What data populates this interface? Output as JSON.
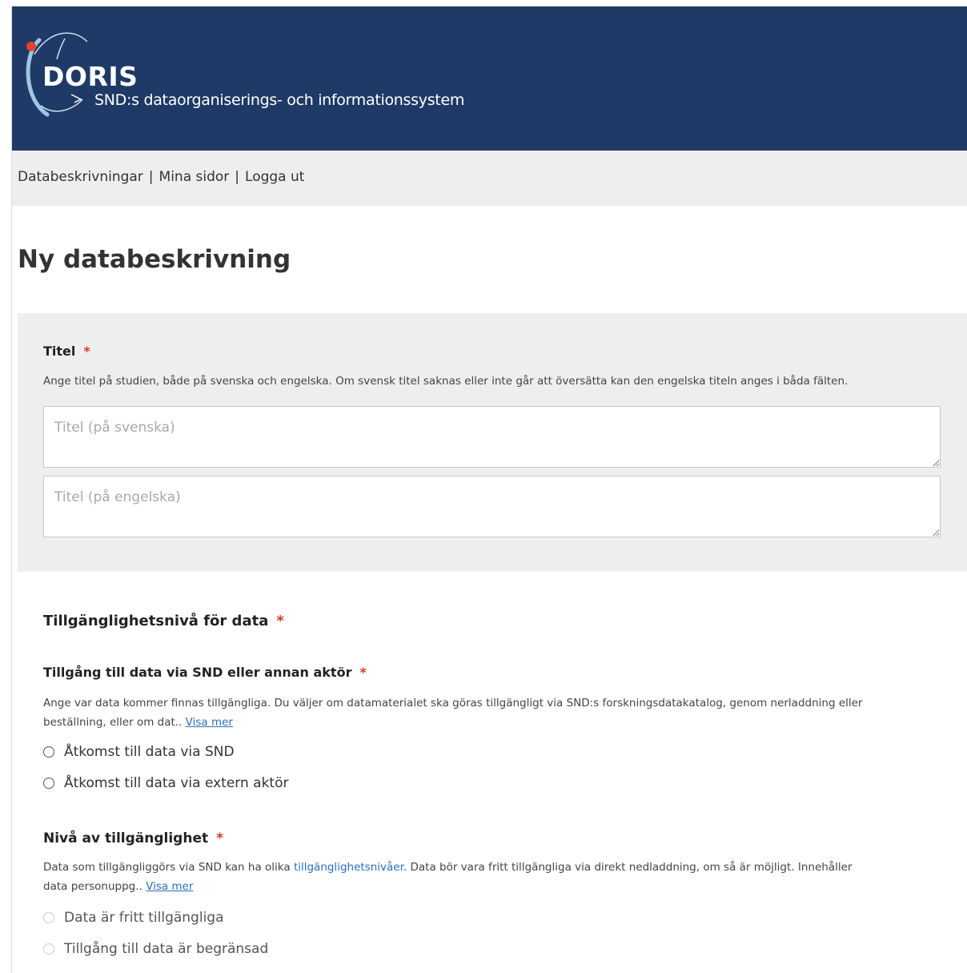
{
  "header": {
    "logo_name": "DORIS",
    "logo_subtitle": "SND:s dataorganiserings- och informationssystem",
    "colors": {
      "background": "#1f3a66",
      "accent_dot": "#e8412f",
      "arc": "#9fc6e6"
    }
  },
  "nav": {
    "items": [
      {
        "label": "Databeskrivningar"
      },
      {
        "label": "Mina sidor"
      },
      {
        "label": "Logga ut"
      }
    ],
    "separator": "|"
  },
  "page": {
    "title": "Ny databeskrivning"
  },
  "titel_section": {
    "label": "Titel",
    "required_mark": "*",
    "help": "Ange titel på studien, både på svenska och engelska. Om svensk titel saknas eller inte går att översätta kan den engelska titeln anges i båda fälten.",
    "swedish_placeholder": "Titel (på svenska)",
    "english_placeholder": "Titel (på engelska)"
  },
  "availability": {
    "heading": "Tillgänglighetsnivå för data",
    "required_mark": "*",
    "access": {
      "label": "Tillgång till data via SND eller annan aktör",
      "required_mark": "*",
      "help_line1": "Ange var data kommer finnas tillgängliga. Du väljer om datamaterialet ska göras tillgängligt via SND:s forskningsdatakatalog, genom nerladdning eller",
      "help_line2": "beställning, eller om dat..",
      "show_more": "Visa mer",
      "options": [
        {
          "label": "Åtkomst till data via SND"
        },
        {
          "label": "Åtkomst till data via extern aktör"
        }
      ]
    },
    "level": {
      "label": "Nivå av tillgänglighet",
      "required_mark": "*",
      "help_line1_a": "Data som tillgängliggörs via SND kan ha olika ",
      "help_link": "tillgänglighetsnivåer",
      "help_line1_b": ". Data bör vara fritt tillgängliga via direkt nedladdning, om så är möjligt. Innehåller",
      "help_line2": "data personuppg..",
      "show_more": "Visa mer",
      "options": [
        {
          "label": "Data är fritt tillgängliga"
        },
        {
          "label": "Tillgång till data är begränsad"
        }
      ]
    }
  }
}
